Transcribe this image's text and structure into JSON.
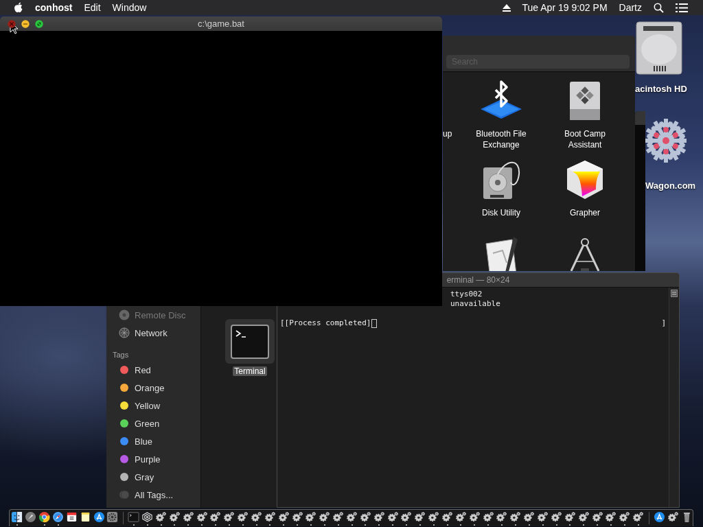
{
  "menu_bar": {
    "app_name": "conhost",
    "menus": [
      "Edit",
      "Window"
    ],
    "clock": "Tue Apr 19  9:02 PM",
    "user": "Dartz"
  },
  "desktop_icons": [
    {
      "kind": "drive",
      "label": "acintosh HD"
    },
    {
      "kind": "snowflake",
      "label": "Wagon.com"
    }
  ],
  "applications_window": {
    "search": {
      "placeholder": "Search"
    },
    "items": [
      {
        "kind": "partial",
        "label": "up"
      },
      {
        "kind": "bluetooth",
        "label": "Bluetooth File Exchange"
      },
      {
        "kind": "bootcamp",
        "label": "Boot Camp Assistant"
      },
      {
        "kind": "disk",
        "label": "Disk Utility"
      },
      {
        "kind": "grapher",
        "label": "Grapher"
      },
      {
        "kind": "drawing"
      },
      {
        "kind": "calipers"
      }
    ]
  },
  "terminal_window": {
    "title": "erminal — 80×24",
    "lines": [
      {
        "kind": "clipped",
        "text": "ttys002"
      },
      {
        "kind": "clipped",
        "text": "unavailable"
      },
      {
        "kind": "full",
        "text": "[[Process completed]"
      }
    ],
    "right_text": "]"
  },
  "finder_window": {
    "sidebar": [
      {
        "kind": "disc",
        "label": "Remote Disc",
        "disabled": true
      },
      {
        "kind": "network",
        "label": "Network",
        "disabled": false
      }
    ],
    "tags_heading": "Tags",
    "tags": [
      {
        "label": "Red",
        "color": "#f05a5a"
      },
      {
        "label": "Orange",
        "color": "#f5a93c"
      },
      {
        "label": "Yellow",
        "color": "#f5dc3a"
      },
      {
        "label": "Green",
        "color": "#5ad25a"
      },
      {
        "label": "Blue",
        "color": "#3c8cf5"
      },
      {
        "label": "Purple",
        "color": "#b95ae6"
      },
      {
        "label": "Gray",
        "color": "#b4b4b4"
      }
    ],
    "all_tags": "All Tags...",
    "files": [
      {
        "label": "Terminal",
        "selected": true
      }
    ]
  },
  "conhost_window": {
    "title": "c:\\game.bat"
  },
  "dock": {
    "items": [
      {
        "kind": "finder",
        "running": true
      },
      {
        "kind": "rocket",
        "running": false
      },
      {
        "kind": "chrome",
        "running": true
      },
      {
        "kind": "compass",
        "running": true
      },
      {
        "kind": "calendar",
        "running": false
      },
      {
        "kind": "notes",
        "running": false
      },
      {
        "kind": "appstore",
        "running": false
      },
      {
        "kind": "settings",
        "running": false
      },
      {
        "kind": "separator"
      },
      {
        "kind": "terminal",
        "running": true
      },
      {
        "kind": "web",
        "running": true
      },
      {
        "kind": "gears",
        "running": true
      },
      {
        "kind": "gears",
        "running": true
      },
      {
        "kind": "gears",
        "running": true
      },
      {
        "kind": "gears",
        "running": true
      },
      {
        "kind": "gears",
        "running": true
      },
      {
        "kind": "gears",
        "running": true
      },
      {
        "kind": "gears",
        "running": true
      },
      {
        "kind": "gears",
        "running": true
      },
      {
        "kind": "gears",
        "running": true
      },
      {
        "kind": "gears",
        "running": true
      },
      {
        "kind": "gears",
        "running": true
      },
      {
        "kind": "gears",
        "running": true
      },
      {
        "kind": "gears",
        "running": true
      },
      {
        "kind": "gears",
        "running": true
      },
      {
        "kind": "gears",
        "running": true
      },
      {
        "kind": "gears",
        "running": true
      },
      {
        "kind": "gears",
        "running": true
      },
      {
        "kind": "gears",
        "running": true
      },
      {
        "kind": "gears",
        "running": true
      },
      {
        "kind": "gears",
        "running": true
      },
      {
        "kind": "gears",
        "running": true
      },
      {
        "kind": "gears",
        "running": true
      },
      {
        "kind": "gears",
        "running": true
      },
      {
        "kind": "gears",
        "running": true
      },
      {
        "kind": "gears",
        "running": true
      },
      {
        "kind": "gears",
        "running": true
      },
      {
        "kind": "gears",
        "running": true
      },
      {
        "kind": "gears",
        "running": true
      },
      {
        "kind": "gears",
        "running": true
      },
      {
        "kind": "gears",
        "running": true
      },
      {
        "kind": "gears",
        "running": true
      },
      {
        "kind": "gears",
        "running": true
      },
      {
        "kind": "gears",
        "running": true
      },
      {
        "kind": "gears",
        "running": true
      },
      {
        "kind": "gears",
        "running": true
      },
      {
        "kind": "gears",
        "running": true
      },
      {
        "kind": "separator"
      },
      {
        "kind": "appstore",
        "running": false
      },
      {
        "kind": "gears",
        "running": false
      },
      {
        "kind": "trash",
        "running": false
      }
    ]
  }
}
